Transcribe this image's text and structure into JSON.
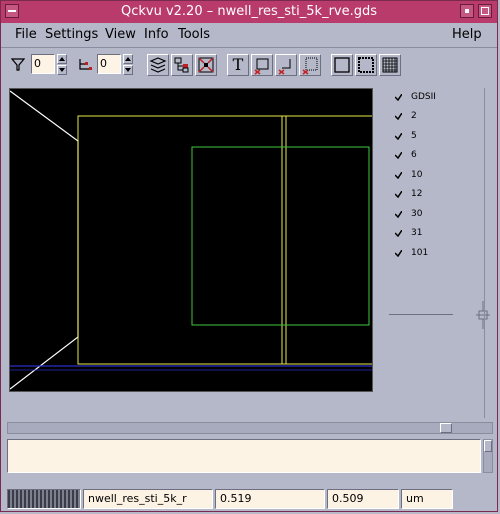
{
  "window": {
    "title": "Qckvu v2.20 – nwell_res_sti_5k_rve.gds"
  },
  "menu": {
    "file": "File",
    "settings": "Settings",
    "view": "View",
    "info": "Info",
    "tools": "Tools",
    "help": "Help"
  },
  "toolbar": {
    "filter_value": "0",
    "hierarchy_value": "0",
    "text_button": "T"
  },
  "layers": [
    {
      "label": "GDSII",
      "checked": true
    },
    {
      "label": "2",
      "checked": true
    },
    {
      "label": "5",
      "checked": true
    },
    {
      "label": "6",
      "checked": true
    },
    {
      "label": "10",
      "checked": true
    },
    {
      "label": "12",
      "checked": true
    },
    {
      "label": "30",
      "checked": true
    },
    {
      "label": "31",
      "checked": true
    },
    {
      "label": "101",
      "checked": true
    }
  ],
  "status": {
    "cell_name": "nwell_res_sti_5k_r",
    "x_coord": "0.519",
    "y_coord": "0.509",
    "units": "um"
  },
  "colors": {
    "titlebar": "#b83b6b",
    "canvas_bg": "#000000",
    "yellow_layer": "#e8e84a",
    "green_layer": "#3ec83e",
    "blue_layer": "#2c2cc8"
  }
}
